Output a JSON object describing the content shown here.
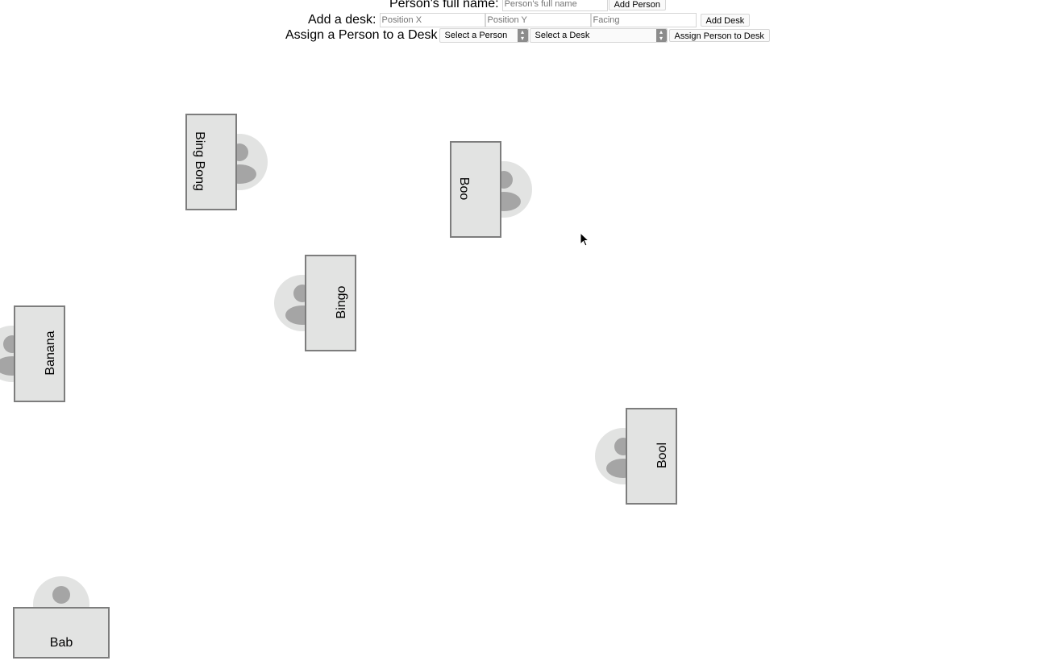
{
  "form": {
    "person": {
      "label": "Person's full name:",
      "name_placeholder": "Person's full name",
      "add_button": "Add Person"
    },
    "desk": {
      "label": "Add a desk:",
      "x_placeholder": "Position X",
      "y_placeholder": "Position Y",
      "facing_placeholder": "Facing",
      "add_button": "Add Desk"
    },
    "assign": {
      "label": "Assign a Person to a Desk",
      "person_select": "Select a Person",
      "desk_select": "Select a Desk",
      "assign_button": "Assign Person to Desk"
    }
  },
  "desks": [
    {
      "name": "Bing Bong",
      "facing": "right"
    },
    {
      "name": "Boo",
      "facing": "right"
    },
    {
      "name": "Bingo",
      "facing": "left"
    },
    {
      "name": "Banana",
      "facing": "left"
    },
    {
      "name": "Bool",
      "facing": "left"
    },
    {
      "name": "Bab",
      "facing": "up"
    }
  ],
  "colors": {
    "desk_fill": "#e2e3e2",
    "desk_border": "#7d7d7d",
    "avatar_icon": "#a5a5a5"
  }
}
